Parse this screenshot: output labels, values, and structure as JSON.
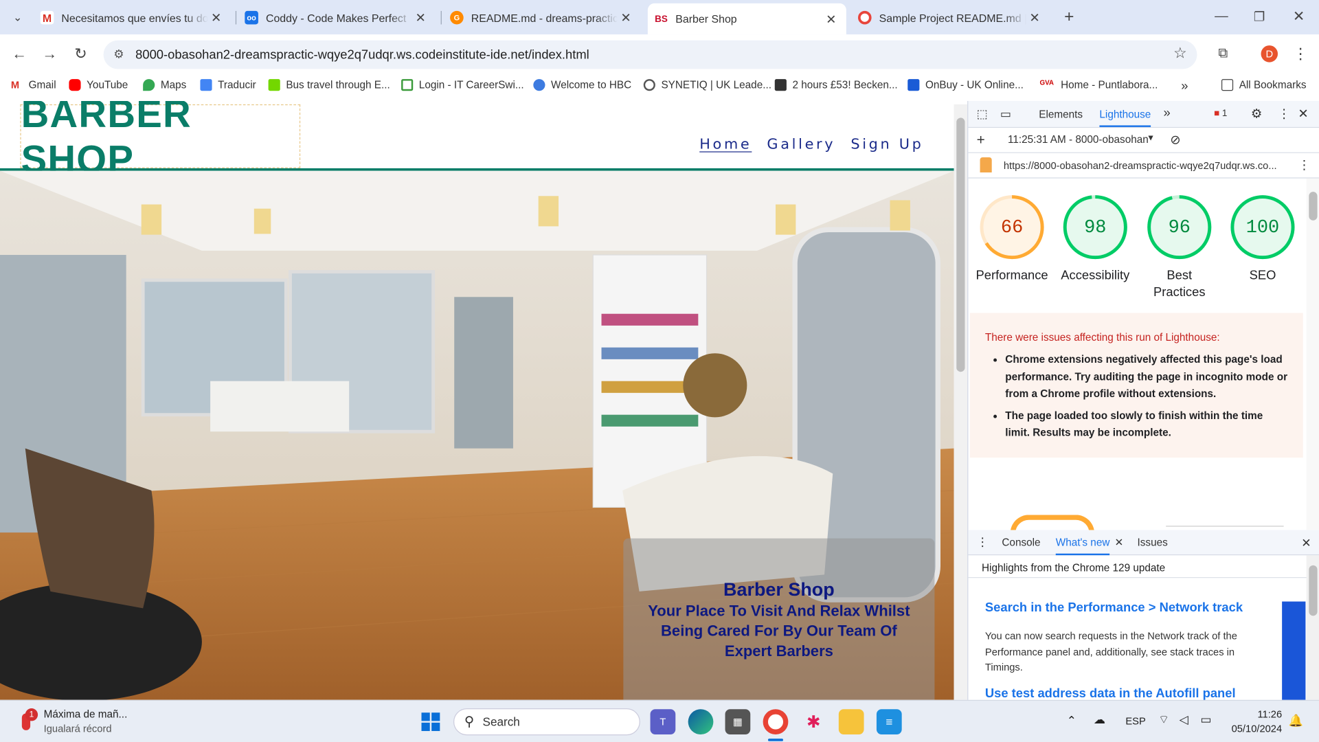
{
  "tabs": [
    {
      "title": "Necesitamos que envíes tu doc",
      "favicon": "gmail-icon",
      "active": false
    },
    {
      "title": "Coddy - Code Makes Perfect",
      "favicon": "coddy-icon",
      "active": false
    },
    {
      "title": "README.md - dreams-practical",
      "favicon": "gitpod-icon",
      "active": false
    },
    {
      "title": "Barber Shop",
      "favicon": "bs-icon",
      "active": true
    },
    {
      "title": "Sample Project README.md | P",
      "favicon": "record-icon",
      "active": false
    }
  ],
  "address": {
    "url": "8000-obasohan2-dreamspractic-wqye2q7udqr.ws.codeinstitute-ide.net/index.html",
    "profile_initial": "D"
  },
  "bookmarks": [
    "Gmail",
    "YouTube",
    "Maps",
    "Traducir",
    "Bus travel through E...",
    "Login - IT CareerSwi...",
    "Welcome to HBC",
    "SYNETIQ | UK Leade...",
    "2 hours £53! Becken...",
    "OnBuy - UK Online...",
    "Home - Puntlabora...",
    "All Bookmarks"
  ],
  "site": {
    "logo": "BARBER SHOP",
    "nav": [
      "Home",
      "Gallery",
      "Sign Up"
    ],
    "hero_title": "Barber Shop",
    "hero_subtitle": "Your Place To Visit And Relax Whilst Being Cared For By Our Team Of Expert Barbers"
  },
  "devtools": {
    "tabs": [
      "Elements",
      "Lighthouse"
    ],
    "active_tab": "Lighthouse",
    "issues_count": "1",
    "report_time": "11:25:31 AM - 8000-obasohan",
    "report_url": "https://8000-obasohan2-dreamspractic-wqye2q7udqr.ws.co...",
    "scores": [
      {
        "label": "Performance",
        "value": 66,
        "color": "#fa3"
      },
      {
        "label": "Accessibility",
        "value": 98,
        "color": "#0c6"
      },
      {
        "label": "Best Practices",
        "value": 96,
        "color": "#0c6"
      },
      {
        "label": "SEO",
        "value": 100,
        "color": "#0c6"
      }
    ],
    "warning_title": "There were issues affecting this run of Lighthouse:",
    "warnings": [
      "Chrome extensions negatively affected this page's load performance. Try auditing the page in incognito mode or from a Chrome profile without extensions.",
      "The page loaded too slowly to finish within the time limit. Results may be incomplete."
    ],
    "drawer_tabs": [
      "Console",
      "What's new",
      "Issues"
    ],
    "drawer_active": "What's new",
    "drawer_header": "Highlights from the Chrome 129 update",
    "drawer_link1": "Search in the Performance > Network track",
    "drawer_text1": "You can now search requests in the Network track of the Performance panel and, additionally, see stack traces in Timings.",
    "drawer_link2": "Use test address data in the Autofill panel"
  },
  "taskbar": {
    "weather_title": "Máxima de mañ...",
    "weather_sub": "Igualará récord",
    "weather_badge": "1",
    "search": "Search",
    "lang": "ESP",
    "time": "11:26",
    "date": "05/10/2024"
  }
}
